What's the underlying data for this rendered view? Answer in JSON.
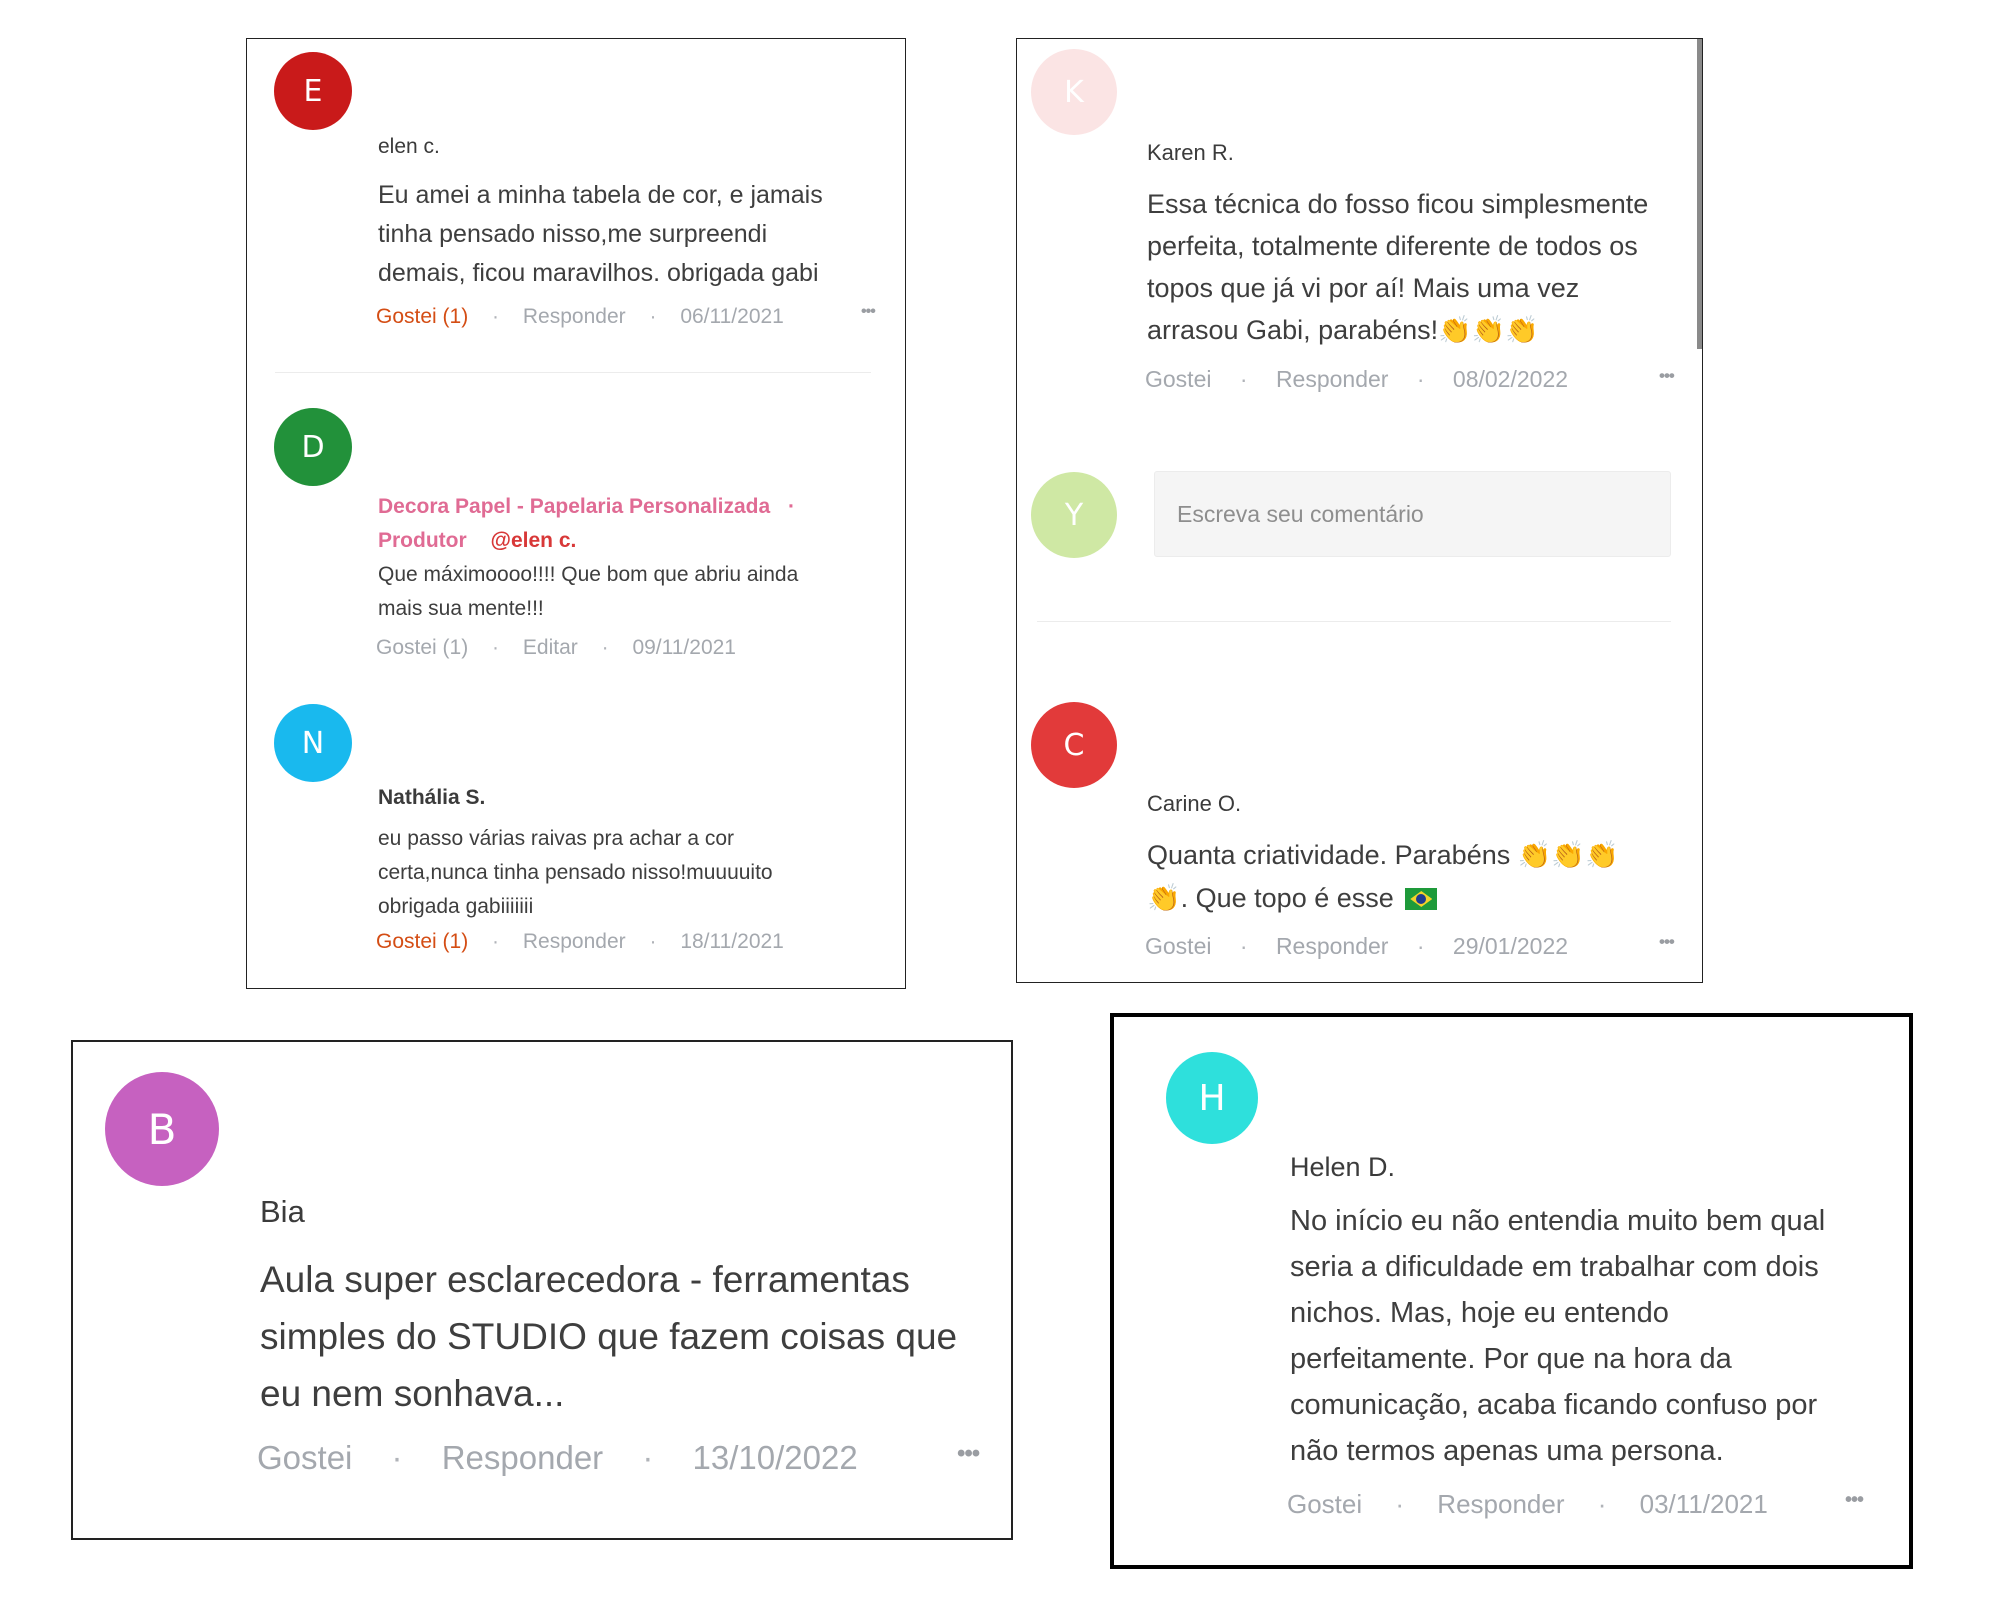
{
  "panel_top_left": {
    "comments": [
      {
        "avatar_letter": "E",
        "avatar_color": "#c91a1a",
        "author": "elen c.",
        "text_lines": [
          "Eu amei a minha tabela de cor, e jamais",
          "tinha pensado nisso,me surpreendi",
          "demais, ficou maravilhos. obrigada gabi"
        ],
        "like_label": "Gostei (1)",
        "reply_label": "Responder",
        "date": "06/11/2021",
        "more_label": "•••"
      },
      {
        "avatar_letter": "D",
        "avatar_color": "#22913a",
        "author_line1": "Decora Papel - Papelaria Personalizada",
        "author_line1_dot": "·",
        "author_line2": "Produtor",
        "mention": "@elen c.",
        "text_lines": [
          "Que máximoooo!!!! Que bom que abriu ainda",
          "mais sua mente!!!"
        ],
        "like_label": "Gostei (1)",
        "edit_label": "Editar",
        "date": "09/11/2021"
      },
      {
        "avatar_letter": "N",
        "avatar_color": "#19b9ee",
        "author": "Nathália S.",
        "text_lines": [
          "eu passo várias raivas pra achar a cor",
          "certa,nunca tinha pensado nisso!muuuuito",
          "obrigada gabiiiiiii"
        ],
        "like_label": "Gostei (1)",
        "reply_label": "Responder",
        "date": "18/11/2021"
      }
    ]
  },
  "panel_top_right": {
    "comments": [
      {
        "avatar_letter": "K",
        "avatar_color": "#fbe4e4",
        "author": "Karen R.",
        "text_lines": [
          "Essa técnica do fosso ficou simplesmente",
          "perfeita, totalmente diferente de todos os",
          "topos que já vi por aí! Mais uma vez",
          "arrasou Gabi, parabéns!"
        ],
        "emoji": "👏👏👏",
        "like_label": "Gostei",
        "reply_label": "Responder",
        "date": "08/02/2022",
        "more_label": "•••"
      },
      {
        "avatar_letter": "C",
        "avatar_color": "#e23a3a",
        "author": "Carine O.",
        "text_line1": "Quanta criatividade. Parabéns ",
        "emoji1": "👏👏👏",
        "emoji2": "👏",
        "text_line2": ". Que topo é esse ",
        "like_label": "Gostei",
        "reply_label": "Responder",
        "date": "29/01/2022",
        "more_label": "•••"
      }
    ],
    "composer": {
      "avatar_letter": "Y",
      "avatar_color": "#cfe8a4",
      "placeholder": "Escreva seu comentário"
    }
  },
  "panel_bottom_left": {
    "avatar_letter": "B",
    "avatar_color": "#c661c0",
    "author": "Bia",
    "text_lines": [
      "Aula super esclarecedora - ferramentas",
      "simples do STUDIO que fazem coisas que",
      "eu nem sonhava..."
    ],
    "like_label": "Gostei",
    "reply_label": "Responder",
    "date": "13/10/2022",
    "more_label": "•••"
  },
  "panel_bottom_right": {
    "avatar_letter": "H",
    "avatar_color": "#2ee0dc",
    "author": "Helen D.",
    "text_lines": [
      "No início eu não entendia muito bem qual",
      "seria a dificuldade em trabalhar com dois",
      "nichos. Mas, hoje eu entendo",
      "perfeitamente. Por que na hora da",
      "comunicação, acaba ficando confuso por",
      "não termos apenas uma persona."
    ],
    "like_label": "Gostei",
    "reply_label": "Responder",
    "date": "03/11/2021",
    "more_label": "•••"
  },
  "separator_dot": "·"
}
